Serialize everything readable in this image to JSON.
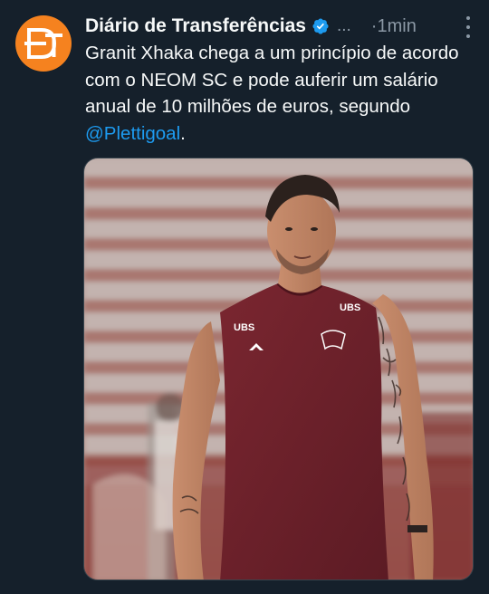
{
  "tweet": {
    "author_name": "Diário de Transferências",
    "handle_truncated": "...",
    "time_separator": "·",
    "time": "1min",
    "text_main": "Granit Xhaka chega a um princípio de acordo com o NEOM SC e pode auferir um salário anual de 10 milhões de euros, segundo ",
    "mention": "@Plettigoal",
    "text_end": ".",
    "avatar_logo": "DT",
    "media": {
      "jersey_sponsor_left": "UBS",
      "jersey_sponsor_right": "UBS",
      "icon": "photo-of-player"
    }
  },
  "colors": {
    "background": "#15202b",
    "text": "#f7f9f9",
    "secondary": "#8b98a5",
    "link": "#1d9bf0",
    "avatar": "#f5821f",
    "verified": "#1d9bf0"
  }
}
